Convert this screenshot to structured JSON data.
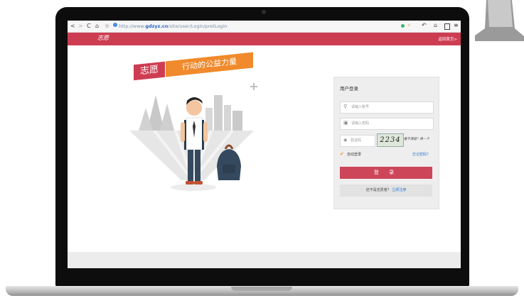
{
  "browser": {
    "url_prefix": "http://www.",
    "url_domain": "gdzyz.cn",
    "url_path": "/site/user/Login/pretLogin",
    "nav_back": "<",
    "nav_forward": ">",
    "nav_reload": "C",
    "nav_home": "⌂",
    "nav_star": "☆"
  },
  "header": {
    "logo_text": "志愿",
    "home_link": "返回首页>"
  },
  "hero": {
    "badge_red": "志愿",
    "badge_orange": "行动的公益力量"
  },
  "login": {
    "title": "用户登录",
    "account_placeholder": "请输入账号",
    "password_placeholder": "请输入密码",
    "captcha_placeholder": "验证码",
    "captcha_code": "2234",
    "captcha_refresh": "看不清楚？换一个",
    "remember_label": "自动登录",
    "forgot_label": "忘记密码？",
    "submit_label": "登 录",
    "register_prompt": "还不是志愿者？",
    "register_link": "立即注册"
  },
  "colors": {
    "brand_red": "#cd3d52",
    "accent_orange": "#f08a2c",
    "link_blue": "#2c7ad6"
  }
}
